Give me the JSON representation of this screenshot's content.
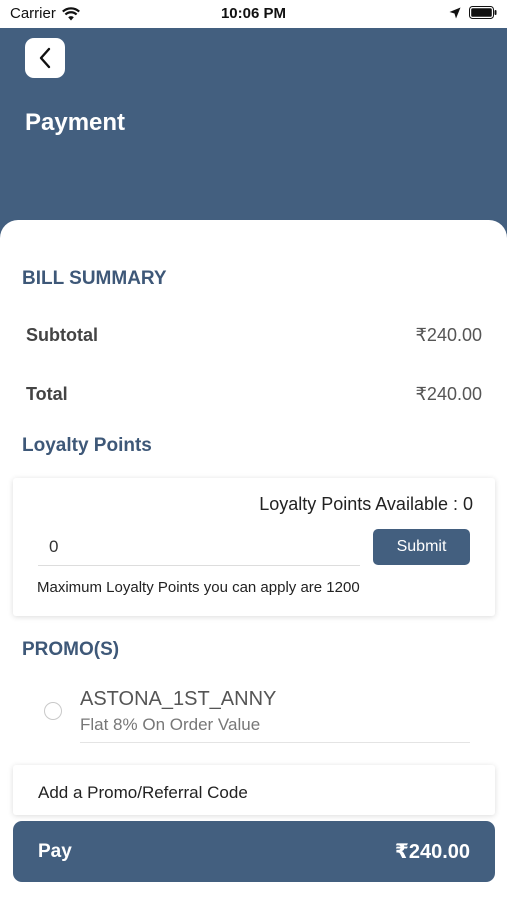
{
  "status_bar": {
    "carrier": "Carrier",
    "time": "10:06 PM"
  },
  "header": {
    "title": "Payment",
    "back_icon": "chevron-left-icon"
  },
  "bill_summary": {
    "title": "BILL SUMMARY",
    "rows": [
      {
        "label": "Subtotal",
        "value": "₹240.00"
      },
      {
        "label": "Total",
        "value": "₹240.00"
      }
    ]
  },
  "loyalty": {
    "title": "Loyalty Points",
    "available": "Loyalty Points Available : 0",
    "input_value": "0",
    "submit_label": "Submit",
    "note": "Maximum Loyalty Points you can apply are 1200"
  },
  "promos": {
    "title": "PROMO(S)",
    "items": [
      {
        "code": "ASTONA_1ST_ANNY",
        "description": "Flat 8% On Order Value"
      }
    ],
    "referral_label": "Add a Promo/Referral Code"
  },
  "pay": {
    "label": "Pay",
    "amount": "₹240.00"
  },
  "colors": {
    "primary": "#435f7f",
    "section_title": "#3e5878"
  }
}
